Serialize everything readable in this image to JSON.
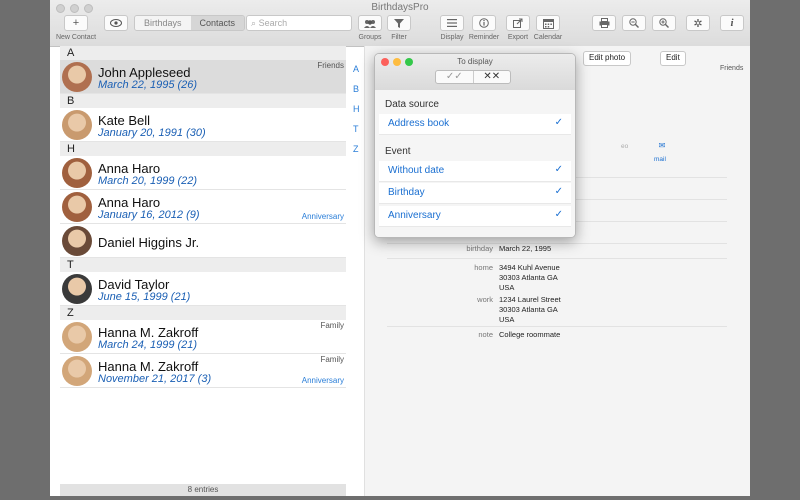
{
  "window": {
    "title": "BirthdaysPro"
  },
  "toolbar": {
    "new_contact": "New Contact",
    "add_glyph": "+",
    "seg_birthdays": "Birthdays",
    "seg_contacts": "Contacts",
    "search_placeholder": "Search",
    "groups": "Groups",
    "filter": "Filter",
    "display": "Display",
    "reminder": "Reminder",
    "export": "Export",
    "calendar": "Calendar"
  },
  "contacts": {
    "sections": [
      {
        "letter": "A",
        "rows": [
          {
            "name": "John Appleseed",
            "date": "March 22, 1995 (26)",
            "group": "Friends",
            "event": "",
            "selected": true
          }
        ]
      },
      {
        "letter": "B",
        "rows": [
          {
            "name": "Kate Bell",
            "date": "January 20, 1991 (30)",
            "group": "",
            "event": ""
          }
        ]
      },
      {
        "letter": "H",
        "rows": [
          {
            "name": "Anna Haro",
            "date": "March 20, 1999 (22)",
            "group": "",
            "event": ""
          },
          {
            "name": "Anna Haro",
            "date": "January 16, 2012 (9)",
            "group": "",
            "event": "Anniversary"
          },
          {
            "name": "Daniel Higgins Jr.",
            "date": "",
            "group": "",
            "event": ""
          }
        ]
      },
      {
        "letter": "T",
        "rows": [
          {
            "name": "David Taylor",
            "date": "June 15, 1999 (21)",
            "group": "",
            "event": ""
          }
        ]
      },
      {
        "letter": "Z",
        "rows": [
          {
            "name": "Hanna M. Zakroff",
            "date": "March 24, 1999 (21)",
            "group": "Family",
            "event": ""
          },
          {
            "name": "Hanna M. Zakroff",
            "date": "November 21, 2017 (3)",
            "group": "Family",
            "event": "Anniversary"
          }
        ]
      }
    ],
    "index": [
      "A",
      "B",
      "H",
      "T",
      "Z"
    ],
    "status": "8 entries"
  },
  "detail": {
    "edit_photo": "Edit photo",
    "edit": "Edit",
    "group": "Friends",
    "partial_action": "eo",
    "mail_label": "mail",
    "fields": [
      {
        "label": "birthday",
        "value_lines": [
          "March 22, 1995"
        ]
      },
      {
        "label": "home",
        "value_lines": [
          "3494 Kuhl Avenue",
          "30303 Atlanta GA",
          "USA"
        ]
      },
      {
        "label": "work",
        "value_lines": [
          "1234 Laurel Street",
          "30303 Atlanta GA",
          "USA"
        ]
      },
      {
        "label": "note",
        "value_lines": [
          "College roommate"
        ]
      }
    ]
  },
  "popup": {
    "title": "To display",
    "btn_check_all": "✓✓",
    "btn_uncheck_all": "✕✕",
    "data_source_header": "Data source",
    "data_source_option": "Address book",
    "event_header": "Event",
    "event_options": [
      "Without date",
      "Birthday",
      "Anniversary"
    ],
    "check": "✓"
  },
  "colors": {
    "accent": "#1a6fd1",
    "date_blue": "#1a5fb4",
    "close": "#fc605b",
    "minimize": "#fdbc40",
    "zoom": "#34c84a"
  }
}
